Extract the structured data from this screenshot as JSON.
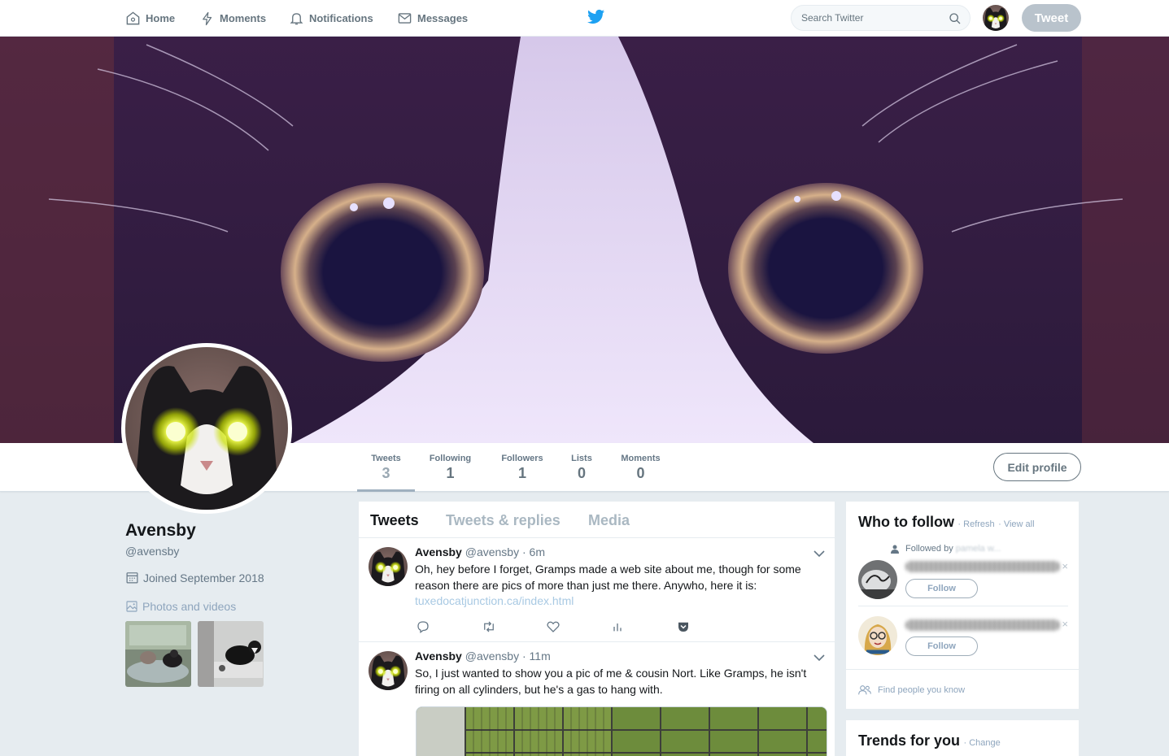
{
  "nav": {
    "home": "Home",
    "moments": "Moments",
    "notifications": "Notifications",
    "messages": "Messages",
    "search_placeholder": "Search Twitter",
    "tweet_button": "Tweet"
  },
  "profile": {
    "name": "Avensby",
    "handle": "@avensby",
    "joined": "Joined September 2018",
    "photos_label": "Photos and videos"
  },
  "stats": [
    {
      "label": "Tweets",
      "value": "3"
    },
    {
      "label": "Following",
      "value": "1"
    },
    {
      "label": "Followers",
      "value": "1"
    },
    {
      "label": "Lists",
      "value": "0"
    },
    {
      "label": "Moments",
      "value": "0"
    }
  ],
  "edit_profile": "Edit profile",
  "timeline": {
    "tabs": [
      "Tweets",
      "Tweets & replies",
      "Media"
    ],
    "tweets": [
      {
        "name": "Avensby",
        "handle": "@avensby",
        "time": "· 6m",
        "text": "Oh, hey before I forget, Gramps made a web site about me, though for some reason there are pics of more than just me there. Anywho, here it is:",
        "link": "tuxedocatjunction.ca/index.html"
      },
      {
        "name": "Avensby",
        "handle": "@avensby",
        "time": "· 11m",
        "text": "So, I just wanted to show you a pic of me & cousin Nort. Like Gramps, he isn't firing on all cylinders, but he's a gas to hang with."
      }
    ]
  },
  "who_to_follow": {
    "title": "Who to follow",
    "refresh": "· Refresh",
    "view_all": "· View all",
    "followed_by": "Followed by",
    "followed_by_name": "pamela w...",
    "follow_label": "Follow",
    "dismiss": "×",
    "find_people": "Find people you know"
  },
  "trends": {
    "title": "Trends for you",
    "change": "· Change"
  },
  "colors": {
    "accent": "#1da1f2",
    "link": "#a8c9e3",
    "muted": "#657786",
    "background": "#e6ecf0"
  }
}
